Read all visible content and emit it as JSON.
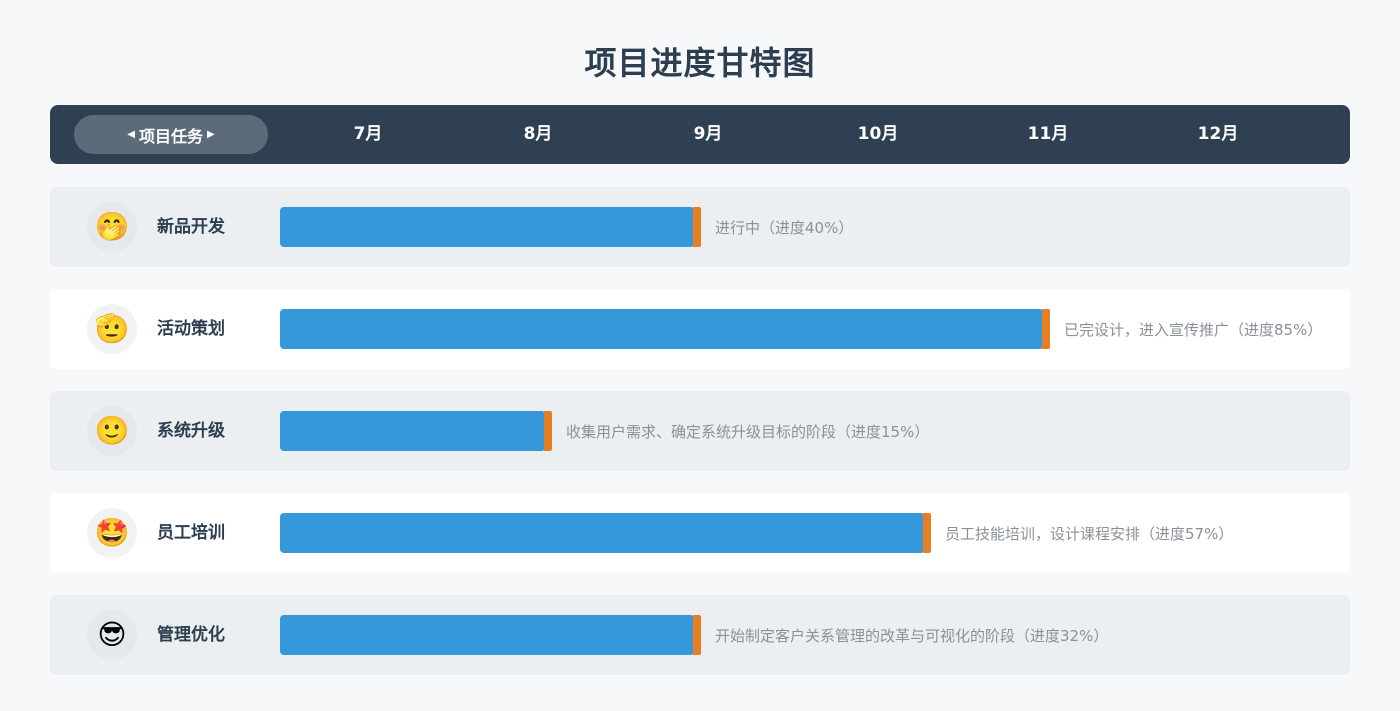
{
  "title": "项目进度甘特图",
  "header": {
    "task_label": "项目任务",
    "months": [
      "7月",
      "8月",
      "9月",
      "10月",
      "11月",
      "12月"
    ]
  },
  "colors": {
    "bar": "#3498db",
    "bar_end": "#e67e22",
    "header_bg": "#2f4052"
  },
  "chart_data": {
    "type": "bar",
    "orientation": "horizontal-gantt",
    "title": "项目进度甘特图",
    "categories": [
      "新品开发",
      "活动策划",
      "系统升级",
      "员工培训",
      "管理优化"
    ],
    "months": [
      "7月",
      "8月",
      "9月",
      "10月",
      "11月",
      "12月"
    ],
    "tasks": [
      {
        "name": "新品开发",
        "icon": "hand-over-mouth-face-icon",
        "emoji": "🤭",
        "start": "7月",
        "end_month_value": 2.55,
        "label": "进行中（进度40%）"
      },
      {
        "name": "活动策划",
        "icon": "saluting-face-icon",
        "emoji": "🫡",
        "start": "7月",
        "end_month_value": 4.6,
        "label": "已完设计，进入宣传推广（进度85%）"
      },
      {
        "name": "系统升级",
        "icon": "smiling-face-icon",
        "emoji": "🙂",
        "start": "7月",
        "end_month_value": 1.67,
        "label": "收集用户需求、确定系统升级目标的阶段（进度15%）"
      },
      {
        "name": "员工培训",
        "icon": "star-struck-face-icon",
        "emoji": "🤩",
        "start": "7月",
        "end_month_value": 3.9,
        "label": "员工技能培训，设计课程安排（进度57%）"
      },
      {
        "name": "管理优化",
        "icon": "sunglasses-face-icon",
        "emoji": "😎",
        "start": "7月",
        "end_month_value": 2.55,
        "label": "开始制定客户关系管理的改革与可视化的阶段（进度32%）"
      }
    ]
  }
}
